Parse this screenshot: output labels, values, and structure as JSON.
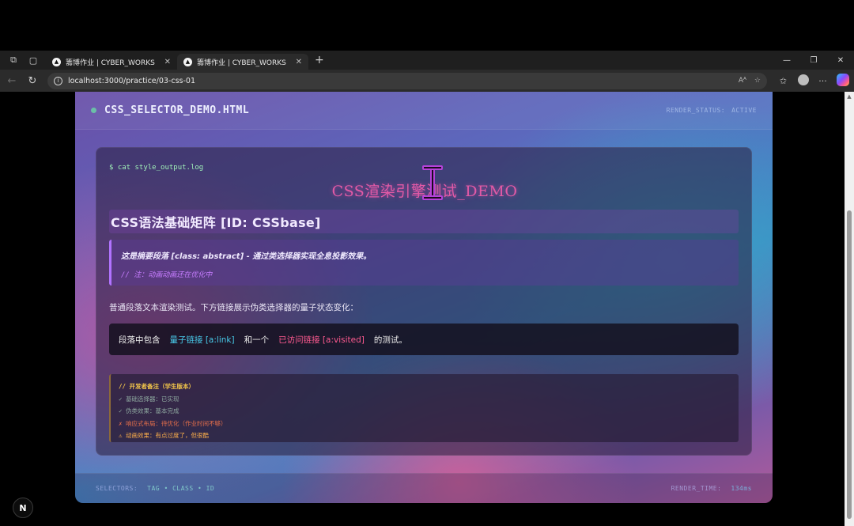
{
  "browser": {
    "tabs": [
      {
        "title": "籌博作业 | CYBER_WORKS",
        "active": false
      },
      {
        "title": "籌博作业 | CYBER_WORKS",
        "active": true
      }
    ],
    "url": "localhost:3000/practice/03-css-01"
  },
  "page": {
    "file_title": "CSS_SELECTOR_DEMO.HTML",
    "render_status_label": "RENDER_STATUS:",
    "render_status_value": "ACTIVE",
    "command": "$ cat style_output.log",
    "big_title": "CSS渲染引擎测试_DEMO",
    "h2": "CSS语法基础矩阵 [ID: CSSbase]",
    "abstract_text": "这是摘要段落 [class: abstract] - 通过类选择器实现全息投影效果。",
    "abstract_note": "// 注：动画动画还在优化中",
    "paragraph": "普通段落文本渲染测试。下方链接展示伪类选择器的量子状态变化：",
    "linkbox": {
      "prefix": "段落中包含",
      "link1": "量子链接 [a:link]",
      "middle": "和一个",
      "link2": "已访问链接 [a:visited]",
      "suffix": "的测试。"
    },
    "devnote": {
      "header": "// 开发者备注（学生版本）",
      "lines": [
        "✓ 基础选择器：已实现",
        "✓ 伪类效果：基本完成",
        "✗ 响应式布局：待优化（作业时间不够）",
        "⚠ 动画效果：有点过度了，但很酷"
      ]
    },
    "footer": {
      "selectors_label": "SELECTORS:",
      "selectors_value": "TAG • CLASS • ID",
      "render_time_label": "RENDER_TIME:",
      "render_time_value": "134ms"
    }
  },
  "badge": "N",
  "colors": {
    "accent_pink": "#e25aa6",
    "link_cyan": "#48c9e8",
    "link_visited": "#ff5a90",
    "note_yellow": "#f5c84a"
  }
}
